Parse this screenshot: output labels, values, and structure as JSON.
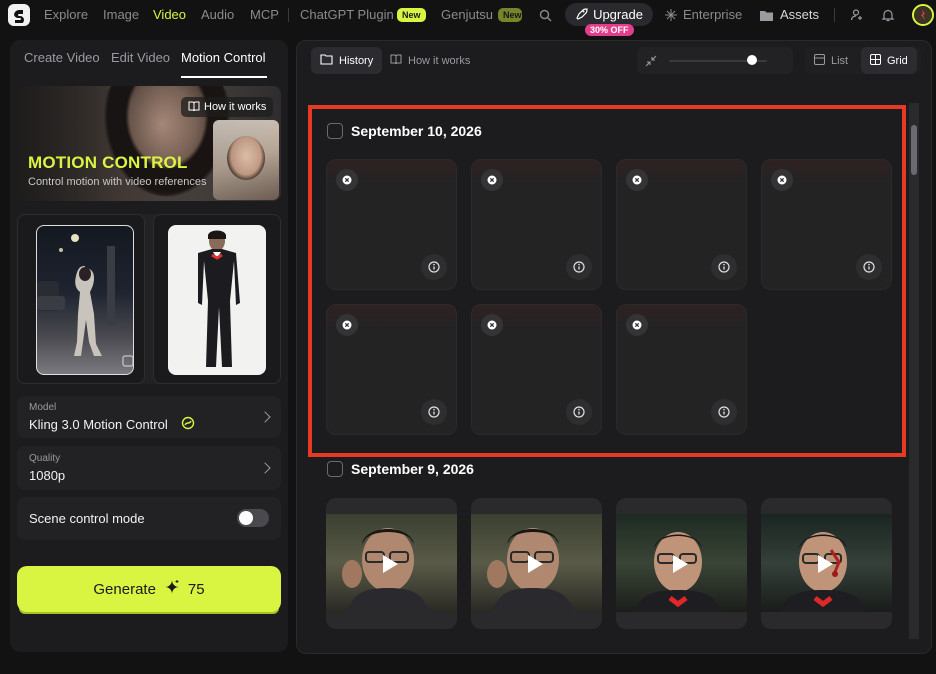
{
  "top_nav": {
    "items": [
      "Explore",
      "Image",
      "Video",
      "Audio",
      "MCP",
      "ChatGPT Plugin",
      "Genjutsu",
      "Enterprise",
      "Assets"
    ],
    "active": "Video",
    "new_badges": [
      "New",
      "New"
    ],
    "upgrade_label": "Upgrade",
    "upgrade_discount": "30% OFF"
  },
  "left_panel": {
    "tabs": [
      "Create Video",
      "Edit Video",
      "Motion Control"
    ],
    "active_tab": "Motion Control",
    "hero": {
      "how_label": "How it works",
      "title": "MOTION CONTROL",
      "subtitle": "Control motion with video references"
    },
    "model": {
      "label": "Model",
      "value": "Kling 3.0 Motion Control"
    },
    "quality": {
      "label": "Quality",
      "value": "1080p"
    },
    "scene_control": {
      "label": "Scene control mode",
      "enabled": false
    },
    "generate": {
      "label": "Generate",
      "cost": "75"
    }
  },
  "toolbar": {
    "history_label": "History",
    "how_label": "How it works",
    "list_label": "List",
    "grid_label": "Grid",
    "active_view": "Grid",
    "zoom_level": 0.85
  },
  "history": {
    "groups": [
      {
        "date": "September 10, 2026",
        "item_count": 7,
        "status": "failed"
      },
      {
        "date": "September 9, 2026",
        "item_count": 4,
        "status": "video"
      }
    ]
  },
  "colors": {
    "accent": "#d9f542",
    "highlight_box": "#e53a24",
    "discount_badge": "#e23e8c"
  }
}
